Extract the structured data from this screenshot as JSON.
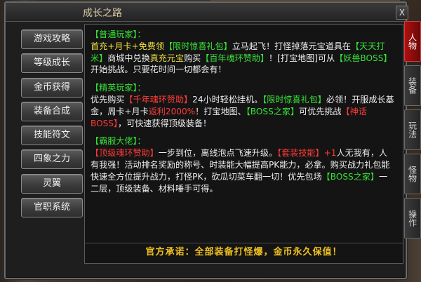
{
  "window": {
    "title": "成长之路",
    "close_label": "X"
  },
  "menu": [
    "游戏攻略",
    "等级成长",
    "金币获得",
    "装备合成",
    "技能符文",
    "四象之力",
    "灵翼",
    "官职系统"
  ],
  "tabs": [
    {
      "label": "人物",
      "active": true
    },
    {
      "label": "装备",
      "active": false
    },
    {
      "label": "玩法",
      "active": false
    },
    {
      "label": "怪物",
      "active": false
    },
    {
      "label": "操作",
      "active": false
    }
  ],
  "sections": {
    "casual": {
      "title": "【普通玩家】：",
      "p1": "首充+月卡+免费领",
      "link1": "【限时惊喜礼包】",
      "p2": "立马起飞！打怪掉落元宝道具在",
      "link2": "【天天打米】",
      "p3": "商城中兑换",
      "link3": "真充元宝",
      "p4": "购买",
      "link4": "【百年魂环赞助】",
      "p5": "！[打宝地图]可从",
      "link5": "【妖兽BOSS】",
      "p6": "开始挑战。只要花时间一切都会有！"
    },
    "elite": {
      "title": "【精英玩家】：",
      "p1": "优先购买",
      "link1": "【千年魂环赞助】",
      "p2": "24小时轻松挂机。",
      "link2": "【限时惊喜礼包】",
      "p3": "必领！开服成长基金，周卡+月卡",
      "link3": "返利2000%",
      "p4": "！打宝地图、",
      "link4": "【BOSS之家】",
      "p5": "可优先挑战",
      "link5": "【神话BOSS】",
      "p6": "，可快速获得顶级装备！"
    },
    "whale": {
      "title": "【霸服大佬】：",
      "link1": "【顶级魂环赞助】",
      "p1": "一步到位，离线泡点飞速升级。",
      "link2": "【套装技能】",
      "link3": "+1",
      "p2": "人无我有，人有我强！活动排名奖励的称号、时装能大幅提高PK能力，必拿。购买战力礼包能快速全方位提升战力，打怪PK，砍瓜切菜车翻一切！优先包场",
      "link4": "【BOSS之家】",
      "p3": "一二层，顶级装备、材料唾手可得。"
    }
  },
  "footer": "官方承诺：全部装备打怪爆，金币永久保值！"
}
